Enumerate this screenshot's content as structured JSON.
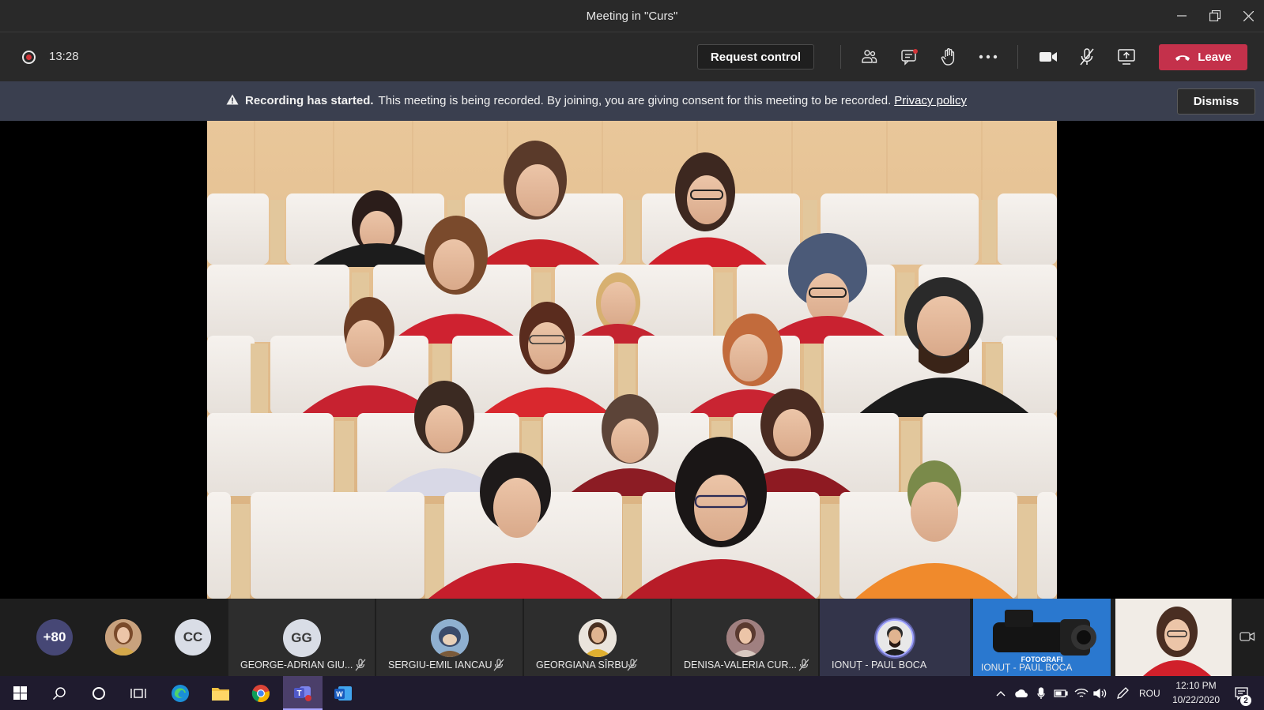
{
  "window": {
    "title": "Meeting in \"Curs\""
  },
  "toolbar": {
    "timer": "13:28",
    "request_control_label": "Request control",
    "leave_label": "Leave"
  },
  "banner": {
    "heading": "Recording has started.",
    "message": "This meeting is being recorded. By joining, you are giving consent for this meeting to be recorded.",
    "link": "Privacy policy",
    "dismiss_label": "Dismiss"
  },
  "participants": {
    "overflow_count": "+80",
    "cc_initials": "CC",
    "tiles": [
      {
        "initials": "GG",
        "name": "GEORGE-ADRIAN GIU..."
      },
      {
        "initials": "",
        "name": "SERGIU-EMIL IANCAU"
      },
      {
        "initials": "",
        "name": "GEORGIANA SÎRBU"
      },
      {
        "initials": "",
        "name": "DENISA-VALERIA CUR..."
      },
      {
        "initials": "",
        "name": "IONUȚ - PAUL BOCA"
      }
    ],
    "screen_share_name": "IONUȚ - PAUL BOCA",
    "screen_share_caption": "FOTOGRAFI"
  },
  "taskbar": {
    "language": "ROU",
    "time": "12:10 PM",
    "date": "10/22/2020",
    "notification_count": "2"
  },
  "colors": {
    "leave": "#c4314b",
    "banner": "#3a3f4f",
    "record": "#d13438",
    "accent": "#6264a7"
  }
}
